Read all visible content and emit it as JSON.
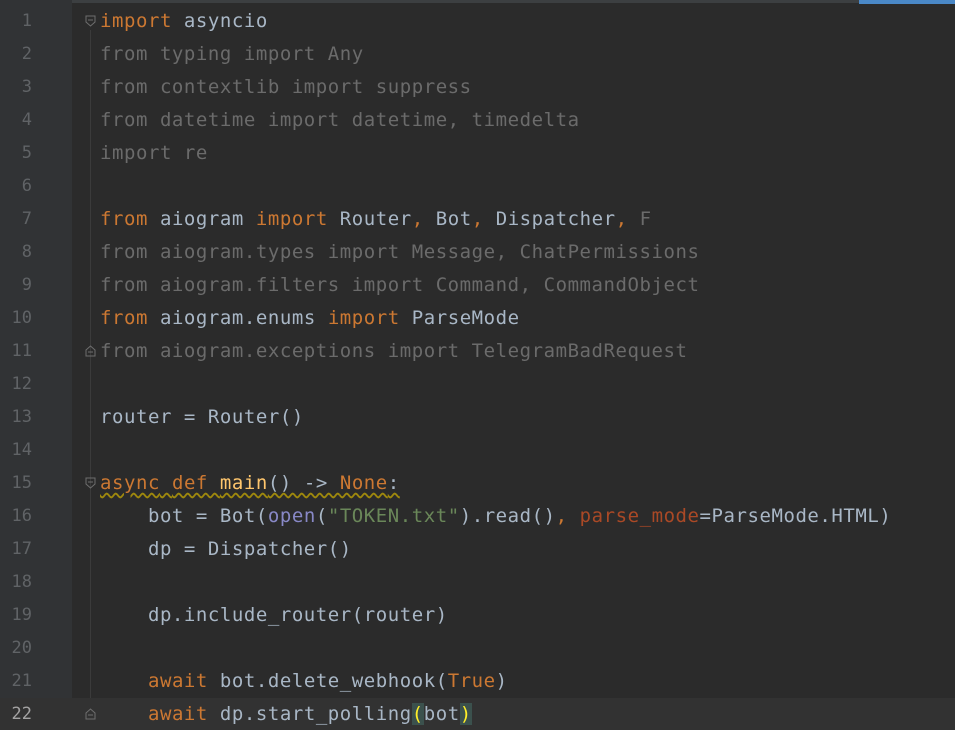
{
  "editor": {
    "current_line": 22,
    "lines": [
      {
        "number": "1",
        "tokens": [
          {
            "t": "import",
            "c": "kw"
          },
          {
            "t": " asyncio",
            "c": ""
          }
        ]
      },
      {
        "number": "2",
        "tokens": [
          {
            "t": "from typing import Any",
            "c": "dim"
          }
        ]
      },
      {
        "number": "3",
        "tokens": [
          {
            "t": "from contextlib import suppress",
            "c": "dim"
          }
        ]
      },
      {
        "number": "4",
        "tokens": [
          {
            "t": "from datetime import datetime, timedelta",
            "c": "dim"
          }
        ]
      },
      {
        "number": "5",
        "tokens": [
          {
            "t": "import re",
            "c": "dim"
          }
        ]
      },
      {
        "number": "6",
        "tokens": []
      },
      {
        "number": "7",
        "tokens": [
          {
            "t": "from",
            "c": "kw"
          },
          {
            "t": " aiogram ",
            "c": ""
          },
          {
            "t": "import",
            "c": "kw"
          },
          {
            "t": " Router",
            "c": ""
          },
          {
            "t": ",",
            "c": "comma"
          },
          {
            "t": " Bot",
            "c": ""
          },
          {
            "t": ",",
            "c": "comma"
          },
          {
            "t": " Dispatcher",
            "c": ""
          },
          {
            "t": ",",
            "c": "comma"
          },
          {
            "t": " F",
            "c": "dim"
          }
        ]
      },
      {
        "number": "8",
        "tokens": [
          {
            "t": "from aiogram.types import Message, ChatPermissions",
            "c": "dim"
          }
        ]
      },
      {
        "number": "9",
        "tokens": [
          {
            "t": "from aiogram.filters import Command, CommandObject",
            "c": "dim"
          }
        ]
      },
      {
        "number": "10",
        "tokens": [
          {
            "t": "from",
            "c": "kw"
          },
          {
            "t": " aiogram.enums ",
            "c": ""
          },
          {
            "t": "import",
            "c": "kw"
          },
          {
            "t": " ParseMode",
            "c": ""
          }
        ]
      },
      {
        "number": "11",
        "tokens": [
          {
            "t": "from aiogram.exceptions import TelegramBadRequest",
            "c": "dim"
          }
        ]
      },
      {
        "number": "12",
        "tokens": []
      },
      {
        "number": "13",
        "tokens": [
          {
            "t": "router = Router()",
            "c": ""
          }
        ]
      },
      {
        "number": "14",
        "tokens": []
      },
      {
        "number": "15",
        "tokens": [
          {
            "t": "async",
            "c": "kw squiggle"
          },
          {
            "t": " ",
            "c": "squiggle"
          },
          {
            "t": "def",
            "c": "kw squiggle"
          },
          {
            "t": " ",
            "c": "squiggle"
          },
          {
            "t": "main",
            "c": "fn squiggle"
          },
          {
            "t": "() -> ",
            "c": "squiggle"
          },
          {
            "t": "None",
            "c": "none squiggle"
          },
          {
            "t": ":",
            "c": "squiggle"
          }
        ]
      },
      {
        "number": "16",
        "tokens": [
          {
            "t": "    bot = Bot(",
            "c": ""
          },
          {
            "t": "open",
            "c": "builtin"
          },
          {
            "t": "(",
            "c": ""
          },
          {
            "t": "\"TOKEN.txt\"",
            "c": "str"
          },
          {
            "t": ").read()",
            "c": ""
          },
          {
            "t": ",",
            "c": "comma"
          },
          {
            "t": " ",
            "c": ""
          },
          {
            "t": "parse_mode",
            "c": "param"
          },
          {
            "t": "=ParseMode.HTML)",
            "c": ""
          }
        ]
      },
      {
        "number": "17",
        "tokens": [
          {
            "t": "    dp = Dispatcher()",
            "c": ""
          }
        ]
      },
      {
        "number": "18",
        "tokens": []
      },
      {
        "number": "19",
        "tokens": [
          {
            "t": "    dp.include_router(router)",
            "c": ""
          }
        ]
      },
      {
        "number": "20",
        "tokens": []
      },
      {
        "number": "21",
        "tokens": [
          {
            "t": "    ",
            "c": ""
          },
          {
            "t": "await",
            "c": "kw"
          },
          {
            "t": " bot.delete_webhook(",
            "c": ""
          },
          {
            "t": "True",
            "c": "bool"
          },
          {
            "t": ")",
            "c": ""
          }
        ]
      },
      {
        "number": "22",
        "tokens": [
          {
            "t": "    ",
            "c": ""
          },
          {
            "t": "await",
            "c": "kw"
          },
          {
            "t": " dp.start_polling",
            "c": ""
          },
          {
            "t": "(",
            "c": "paren-match"
          },
          {
            "t": "bot",
            "c": ""
          },
          {
            "t": ")",
            "c": "paren-match"
          }
        ]
      }
    ],
    "fold_markers": [
      1,
      11,
      15,
      22
    ]
  }
}
